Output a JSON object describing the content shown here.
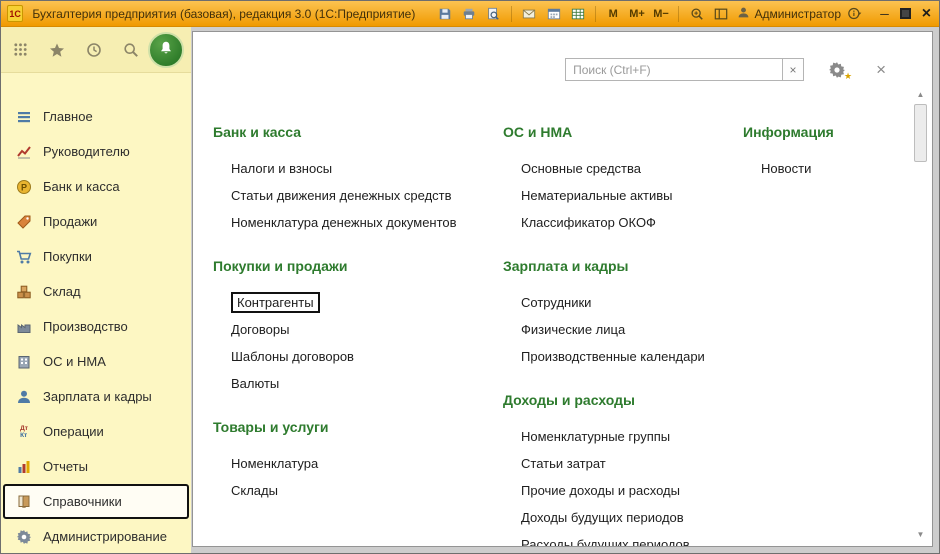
{
  "titlebar": {
    "logo": "1С",
    "title": "Бухгалтерия предприятия (базовая), редакция 3.0  (1С:Предприятие)",
    "memory_buttons": [
      "М",
      "М+",
      "М−"
    ],
    "user": "Администратор",
    "minimize": "─",
    "close": "×"
  },
  "sidebar": {
    "items": [
      {
        "label": "Главное"
      },
      {
        "label": "Руководителю"
      },
      {
        "label": "Банк и касса"
      },
      {
        "label": "Продажи"
      },
      {
        "label": "Покупки"
      },
      {
        "label": "Склад"
      },
      {
        "label": "Производство"
      },
      {
        "label": "ОС и НМА"
      },
      {
        "label": "Зарплата и кадры"
      },
      {
        "label": "Операции"
      },
      {
        "label": "Отчеты"
      },
      {
        "label": "Справочники",
        "selected": true
      },
      {
        "label": "Администрирование"
      }
    ]
  },
  "panel": {
    "search_placeholder": "Поиск (Ctrl+F)",
    "clear_label": "×",
    "close_label": "×",
    "scroll_up": "▲",
    "scroll_down": "▼",
    "columns": [
      {
        "groups": [
          {
            "title": "Банк и касса",
            "links": [
              "Налоги и взносы",
              "Статьи движения денежных средств",
              "Номенклатура денежных документов"
            ]
          },
          {
            "title": "Покупки и продажи",
            "links": [
              "Контрагенты",
              "Договоры",
              "Шаблоны договоров",
              "Валюты"
            ],
            "focused_link": "Контрагенты"
          },
          {
            "title": "Товары и услуги",
            "links": [
              "Номенклатура",
              "Склады"
            ]
          }
        ]
      },
      {
        "groups": [
          {
            "title": "ОС и НМА",
            "links": [
              "Основные средства",
              "Нематериальные активы",
              "Классификатор ОКОФ"
            ]
          },
          {
            "title": "Зарплата и кадры",
            "links": [
              "Сотрудники",
              "Физические лица",
              "Производственные календари"
            ]
          },
          {
            "title": "Доходы и расходы",
            "links": [
              "Номенклатурные группы",
              "Статьи затрат",
              "Прочие доходы и расходы",
              "Доходы будущих периодов",
              "Расходы будущих периодов"
            ]
          }
        ]
      },
      {
        "groups": [
          {
            "title": "Информация",
            "links": [
              "Новости"
            ]
          }
        ]
      }
    ]
  }
}
